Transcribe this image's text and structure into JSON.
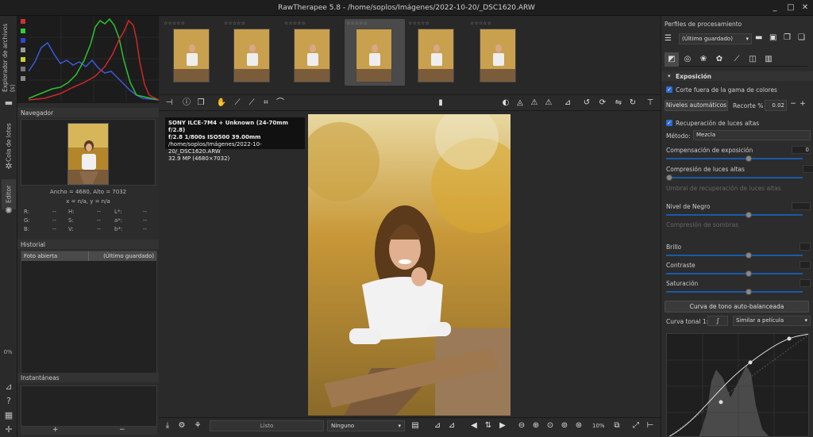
{
  "window": {
    "title": "RawTherapee 5.8 - /home/soplos/Imágenes/2022-10-20/_DSC1620.ARW",
    "controls": [
      "_",
      "□",
      "✕"
    ]
  },
  "vtabs": {
    "file_browser": "Explorador de archivos (s)",
    "queue": "Cola de lotes",
    "editor": "Editor"
  },
  "navigator": {
    "title": "Navegador",
    "dims": "Ancho = 4680, Alto = 7032",
    "xy": "x = n/a, y = n/a",
    "rows": [
      [
        "R:",
        "--",
        "H:",
        "--",
        "L*:",
        "--"
      ],
      [
        "G:",
        "--",
        "S:",
        "--",
        "a*:",
        "--"
      ],
      [
        "B:",
        "--",
        "V:",
        "--",
        "b*:",
        "--"
      ]
    ]
  },
  "history": {
    "title": "Historial",
    "items": [
      {
        "action": "Foto abierta",
        "value": "(Último guardado)"
      }
    ]
  },
  "left_percent": "0%",
  "snapshots": {
    "title": "Instantáneas",
    "add": "+",
    "remove": "−"
  },
  "filmstrip": {
    "stars": "☆☆☆☆☆",
    "count": 6,
    "selected": 3
  },
  "image_info": {
    "line1": "SONY ILCE-7M4 + Unknown (24-70mm f/2.8)",
    "line2": "f/2.8  1/800s  ISO500  39.00mm",
    "line3": "/home/soplos/Imágenes/2022-10-20/_DSC1620.ARW",
    "line4": "32.9 MP (4680×7032)"
  },
  "statusbar": {
    "status": "Listo",
    "output_profile": "Ninguno",
    "zoom": "10%"
  },
  "right": {
    "title": "Perfiles de procesamiento",
    "profile": "(Último guardado)",
    "section": "Exposición",
    "gamut_clip": "Corte fuera de la gama de colores",
    "auto_levels": "Niveles automáticos",
    "clip_label": "Recorte %",
    "clip_value": "0.02",
    "highlight_recovery": "Recuperación de luces altas",
    "method_label": "Método:",
    "method_value": "Mezcla",
    "exposure_comp": "Compensación de exposición",
    "exposure_value": "0",
    "highlight_comp": "Compresión de luces altas",
    "highlight_threshold": "Umbral de recuperación de luces altas",
    "black": "Nivel de Negro",
    "shadow_comp": "Compresión de sombras",
    "brightness": "Brillo",
    "contrast": "Contraste",
    "saturation": "Saturación",
    "auto_curve": "Curva de tono auto-balanceada",
    "tone_curve_label": "Curva tonal 1:",
    "tone_curve_mode": "Similar a película"
  }
}
